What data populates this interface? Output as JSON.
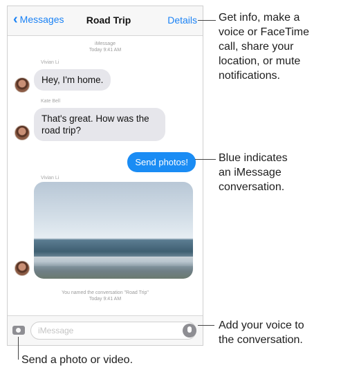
{
  "nav": {
    "back_label": "Messages",
    "title": "Road Trip",
    "details_label": "Details"
  },
  "thread": {
    "header_service": "iMessage",
    "header_time": "Today 9:41 AM",
    "messages": [
      {
        "sender": "Vivian Li",
        "text": "Hey, I'm home.",
        "direction": "incoming"
      },
      {
        "sender": "Kate Bell",
        "text": "That's great. How was the road trip?",
        "direction": "incoming"
      },
      {
        "sender": "",
        "text": "Send photos!",
        "direction": "outgoing"
      },
      {
        "sender": "Vivian Li",
        "text": "",
        "direction": "incoming",
        "type": "photo"
      }
    ],
    "rename_notice": "You named the conversation \"Road Trip\"",
    "rename_time": "Today 9:41 AM"
  },
  "input": {
    "placeholder": "iMessage",
    "camera_icon": "camera-icon",
    "mic_icon": "microphone-icon"
  },
  "callouts": {
    "details": "Get info, make a\nvoice or FaceTime\ncall, share your\nlocation, or mute\nnotifications.",
    "blue": "Blue indicates\nan iMessage\nconversation.",
    "voice": "Add your voice to\nthe conversation.",
    "photo": "Send a photo or video."
  },
  "colors": {
    "accent": "#1a82f5",
    "outgoing_bubble": "#1a8cf4",
    "incoming_bubble": "#e6e6eb"
  }
}
